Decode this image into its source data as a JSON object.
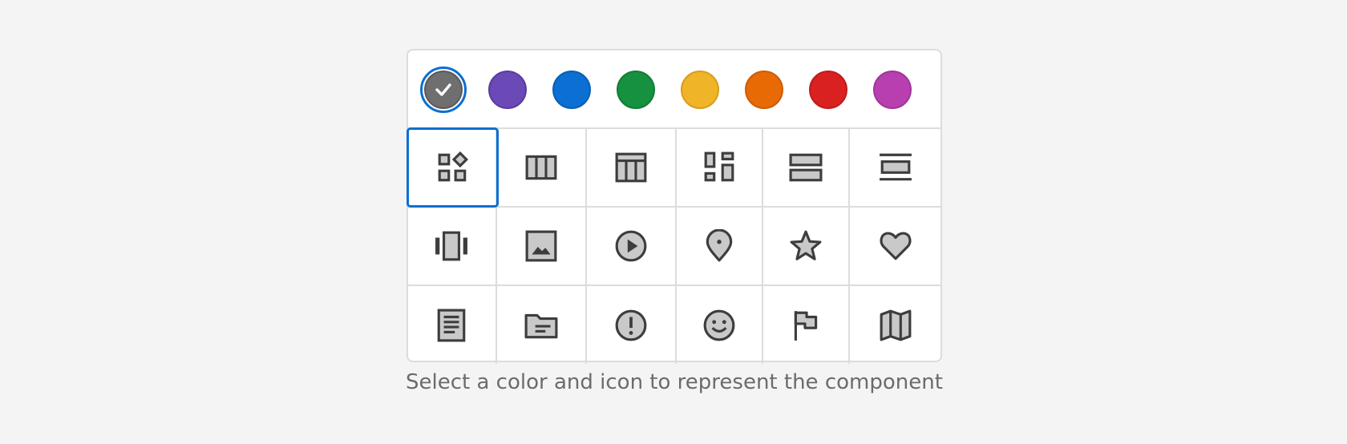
{
  "colors": [
    {
      "name": "gray",
      "hex": "#6f6f6f",
      "border": "#5a5a5a",
      "selected": true
    },
    {
      "name": "purple",
      "hex": "#6b49b6",
      "border": "#5a3ba1",
      "selected": false
    },
    {
      "name": "blue",
      "hex": "#0b6fd3",
      "border": "#0a5fb5",
      "selected": false
    },
    {
      "name": "green",
      "hex": "#15913f",
      "border": "#127d36",
      "selected": false
    },
    {
      "name": "yellow",
      "hex": "#f0b429",
      "border": "#d99d1b",
      "selected": false
    },
    {
      "name": "orange",
      "hex": "#e86a05",
      "border": "#cc5d04",
      "selected": false
    },
    {
      "name": "red",
      "hex": "#d92121",
      "border": "#bf1c1c",
      "selected": false
    },
    {
      "name": "magenta",
      "hex": "#b83fb0",
      "border": "#a23499",
      "selected": false
    }
  ],
  "icons": [
    [
      "components-icon",
      "columns-icon",
      "table-layout-icon",
      "dashboard-icon",
      "rows-icon",
      "list-icon"
    ],
    [
      "carousel-icon",
      "image-icon",
      "play-icon",
      "map-pin-icon",
      "star-icon",
      "heart-icon"
    ],
    [
      "document-icon",
      "folder-icon",
      "alert-icon",
      "smiley-icon",
      "flag-icon",
      "map-icon"
    ]
  ],
  "selected_icon": "components-icon",
  "accent": "#0a6fd1",
  "helper_text": "Select a color and icon to represent the component"
}
